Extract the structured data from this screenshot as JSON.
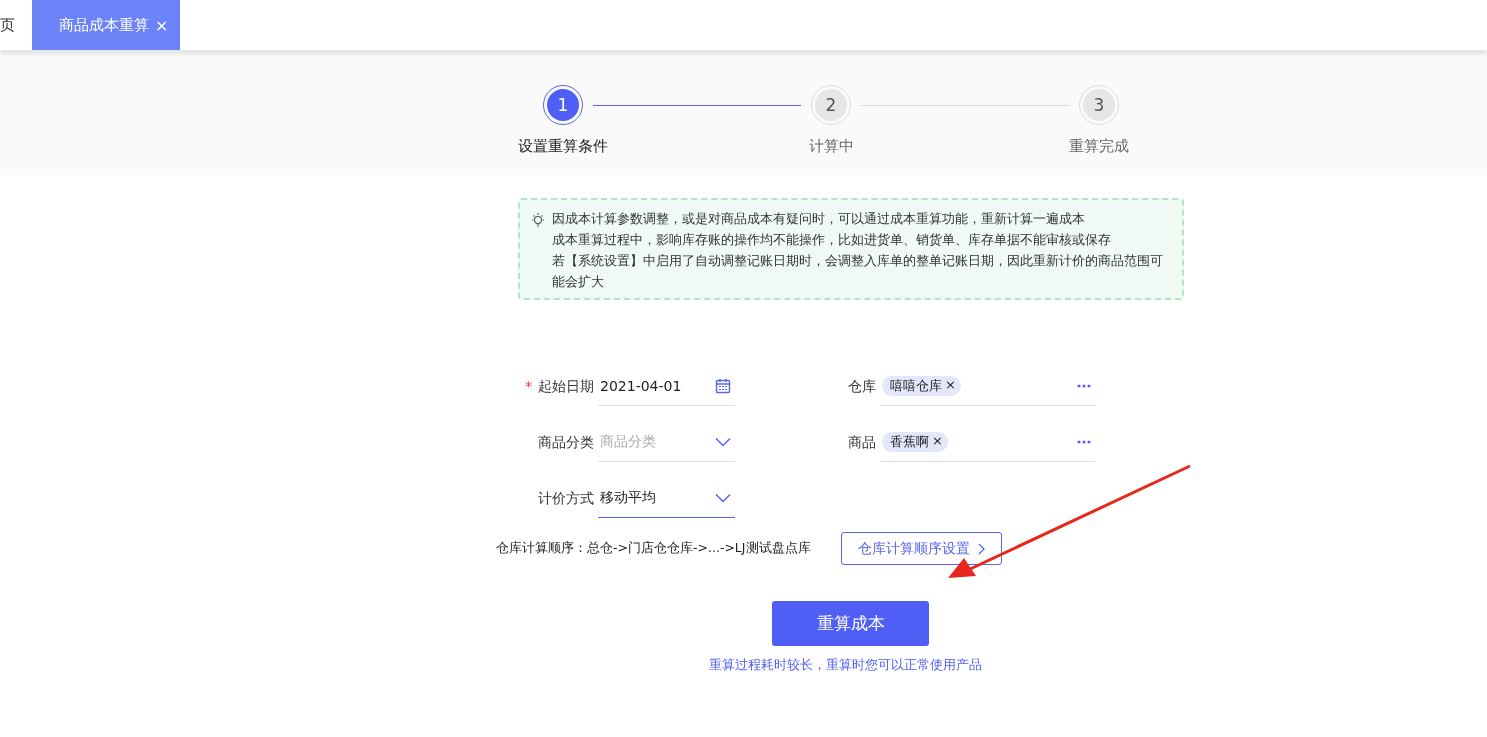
{
  "tabs": [
    {
      "label": "页",
      "selected": false,
      "closable": false
    },
    {
      "label": "商品成本重算",
      "selected": true,
      "closable": true,
      "close": "×"
    }
  ],
  "steps": [
    {
      "number": "1",
      "label": "设置重算条件",
      "selected": true
    },
    {
      "number": "2",
      "label": "计算中",
      "selected": false
    },
    {
      "number": "3",
      "label": "重算完成",
      "selected": false
    }
  ],
  "tip": {
    "lines": [
      "因成本计算参数调整，或是对商品成本有疑问时，可以通过成本重算功能，重新计算一遍成本",
      "成本重算过程中，影响库存账的操作均不能操作，比如进货单、销货单、库存单据不能审核或保存",
      "若【系统设置】中启用了自动调整记账日期时，会调整入库单的整单记账日期，因此重新计价的商品范围可能会扩大"
    ]
  },
  "form": {
    "fields": [
      {
        "kind": "date",
        "label": "起始日期",
        "required": true,
        "value": "2021-04-01",
        "focused": false
      },
      {
        "kind": "tags",
        "label": "仓库",
        "required": false,
        "tags": [
          {
            "text": "嘻嘻仓库",
            "remove": "×"
          }
        ],
        "focused": false
      },
      {
        "kind": "select",
        "label": "商品分类",
        "required": false,
        "placeholder": "商品分类",
        "focused": false
      },
      {
        "kind": "tags",
        "label": "商品",
        "required": false,
        "tags": [
          {
            "text": "香蕉啊",
            "remove": "×"
          }
        ],
        "focused": false
      },
      {
        "kind": "select",
        "label": "计价方式",
        "required": false,
        "value": "移动平均",
        "focused": true
      }
    ],
    "required_mark": "*"
  },
  "order": {
    "text": "仓库计算顺序：总仓->门店仓仓库->...->LJ测试盘点库",
    "button": "仓库计算顺序设置"
  },
  "primary_button": "重算成本",
  "note": "重算过程耗时较长，重算时您可以正常使用产品"
}
